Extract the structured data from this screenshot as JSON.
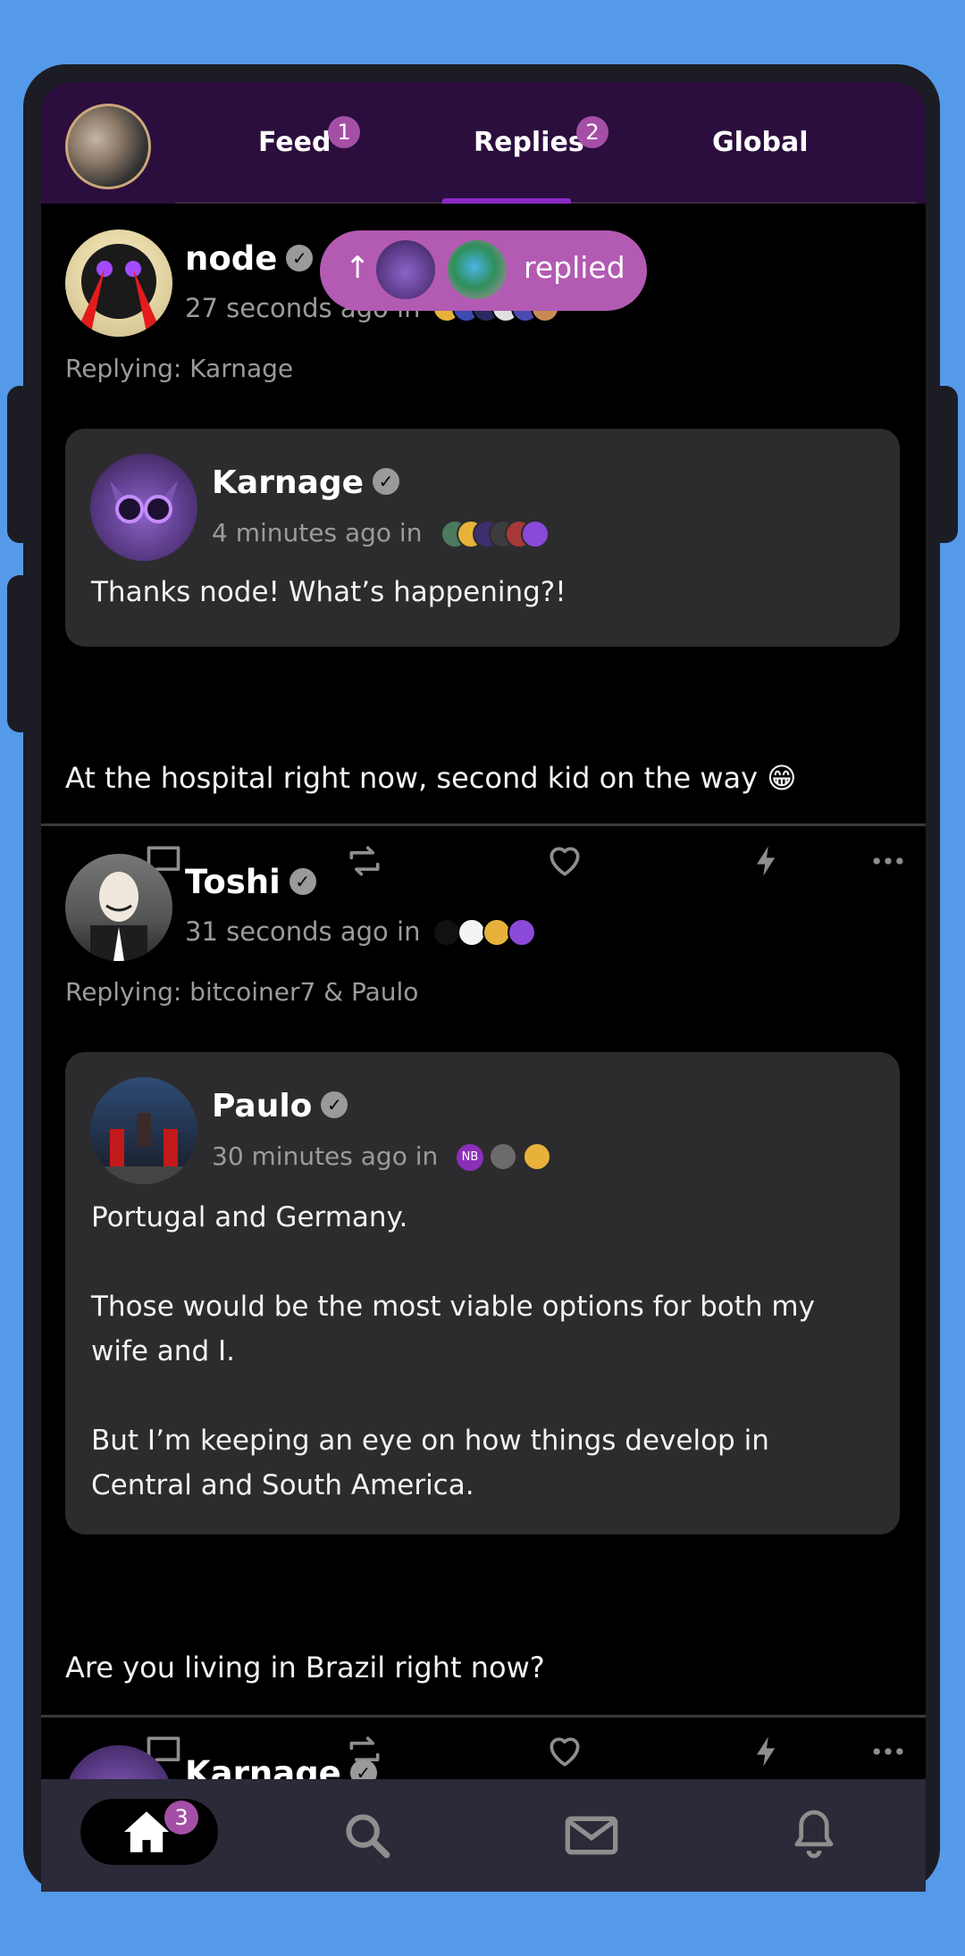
{
  "header": {
    "tabs": [
      {
        "label": "Feed",
        "badge": "1"
      },
      {
        "label": "Replies",
        "badge": "2",
        "active": true
      },
      {
        "label": "Global",
        "badge": ""
      }
    ]
  },
  "notification_pill": {
    "arrow": "↑",
    "label": "replied"
  },
  "posts": [
    {
      "author": "node",
      "time": "27 seconds ago in",
      "replying": "Replying: Karnage",
      "quote": {
        "author": "Karnage",
        "time": "4 minutes ago in",
        "lines": [
          "Thanks node! What’s happening?!"
        ]
      },
      "text": "At the hospital right now, second kid on the way 😁"
    },
    {
      "author": "Toshi",
      "time": "31 seconds ago in",
      "replying": "Replying: bitcoiner7 & Paulo",
      "quote": {
        "author": "Paulo",
        "time": "30 minutes ago in",
        "community_badge": "NB",
        "lines": [
          "Portugal and Germany.",
          "",
          "Those would be the most viable options for both my",
          "wife and I.",
          "",
          "But I’m keeping an eye on how things develop in",
          "Central and South America."
        ]
      },
      "text": "Are you living in Brazil right now?"
    },
    {
      "author": "Karnage"
    }
  ],
  "bottom_nav": {
    "home_badge": "3",
    "items": [
      "home-icon",
      "search-icon",
      "mail-icon",
      "bell-icon"
    ]
  },
  "colors": {
    "background": "#5599e9",
    "header": "#2b0e3d",
    "accent": "#a44fa6",
    "card": "#2c2c2e"
  }
}
